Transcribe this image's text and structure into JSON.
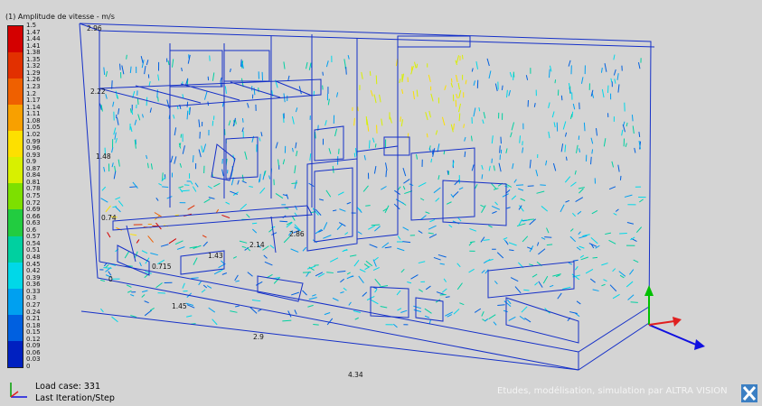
{
  "legend": {
    "title": "(1) Amplitude de vitesse - m/s",
    "ticks": [
      "1.5",
      "1.47",
      "1.44",
      "1.41",
      "1.38",
      "1.35",
      "1.32",
      "1.29",
      "1.26",
      "1.23",
      "1.2",
      "1.17",
      "1.14",
      "1.11",
      "1.08",
      "1.05",
      "1.02",
      "0.99",
      "0.96",
      "0.93",
      "0.9",
      "0.87",
      "0.84",
      "0.81",
      "0.78",
      "0.75",
      "0.72",
      "0.69",
      "0.66",
      "0.63",
      "0.6",
      "0.57",
      "0.54",
      "0.51",
      "0.48",
      "0.45",
      "0.42",
      "0.39",
      "0.36",
      "0.33",
      "0.3",
      "0.27",
      "0.24",
      "0.21",
      "0.18",
      "0.15",
      "0.12",
      "0.09",
      "0.06",
      "0.03",
      "0"
    ],
    "colors": [
      "#d40000",
      "#e23000",
      "#ef6000",
      "#f8a000",
      "#fde000",
      "#d8f000",
      "#7de000",
      "#22cc40",
      "#00d0a0",
      "#00d8e8",
      "#00a0f0",
      "#0060e0",
      "#0020c0"
    ]
  },
  "dimensions": {
    "labels": [
      "2.96",
      "2.22",
      "1.48",
      "0.74",
      "0",
      "0.715",
      "1.43",
      "2.14",
      "2.86",
      "1.45",
      "2.9",
      "4.34"
    ]
  },
  "status": {
    "load_case": "Load case: 331",
    "iteration": "Last Iteration/Step"
  },
  "watermark": "Etudes, modélisation, simulation par ALTRA VISION",
  "axis_triad": {
    "x_color": "#1010e0",
    "y_color": "#00c000",
    "z_color": "#e02020"
  }
}
